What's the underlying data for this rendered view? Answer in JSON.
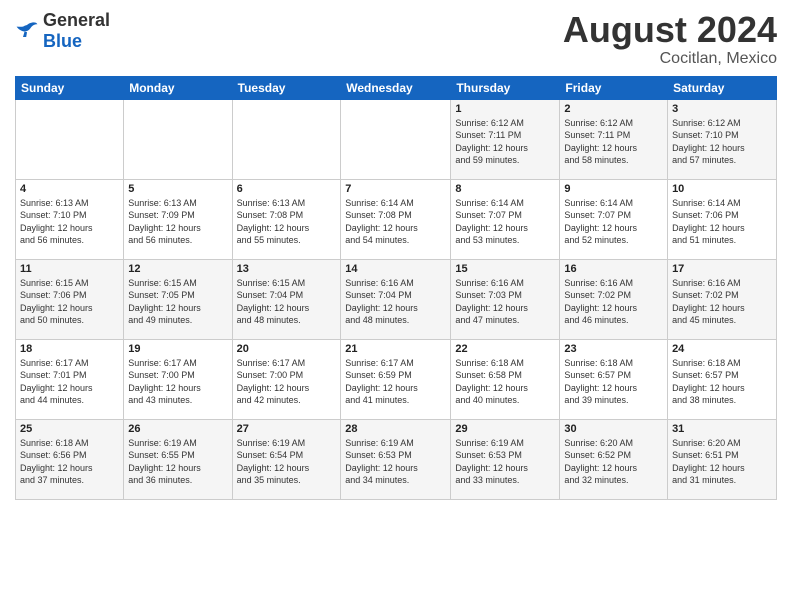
{
  "header": {
    "logo_general": "General",
    "logo_blue": "Blue",
    "main_title": "August 2024",
    "subtitle": "Cocitlan, Mexico"
  },
  "days_of_week": [
    "Sunday",
    "Monday",
    "Tuesday",
    "Wednesday",
    "Thursday",
    "Friday",
    "Saturday"
  ],
  "weeks": [
    [
      {
        "day": "",
        "info": ""
      },
      {
        "day": "",
        "info": ""
      },
      {
        "day": "",
        "info": ""
      },
      {
        "day": "",
        "info": ""
      },
      {
        "day": "1",
        "info": "Sunrise: 6:12 AM\nSunset: 7:11 PM\nDaylight: 12 hours\nand 59 minutes."
      },
      {
        "day": "2",
        "info": "Sunrise: 6:12 AM\nSunset: 7:11 PM\nDaylight: 12 hours\nand 58 minutes."
      },
      {
        "day": "3",
        "info": "Sunrise: 6:12 AM\nSunset: 7:10 PM\nDaylight: 12 hours\nand 57 minutes."
      }
    ],
    [
      {
        "day": "4",
        "info": "Sunrise: 6:13 AM\nSunset: 7:10 PM\nDaylight: 12 hours\nand 56 minutes."
      },
      {
        "day": "5",
        "info": "Sunrise: 6:13 AM\nSunset: 7:09 PM\nDaylight: 12 hours\nand 56 minutes."
      },
      {
        "day": "6",
        "info": "Sunrise: 6:13 AM\nSunset: 7:08 PM\nDaylight: 12 hours\nand 55 minutes."
      },
      {
        "day": "7",
        "info": "Sunrise: 6:14 AM\nSunset: 7:08 PM\nDaylight: 12 hours\nand 54 minutes."
      },
      {
        "day": "8",
        "info": "Sunrise: 6:14 AM\nSunset: 7:07 PM\nDaylight: 12 hours\nand 53 minutes."
      },
      {
        "day": "9",
        "info": "Sunrise: 6:14 AM\nSunset: 7:07 PM\nDaylight: 12 hours\nand 52 minutes."
      },
      {
        "day": "10",
        "info": "Sunrise: 6:14 AM\nSunset: 7:06 PM\nDaylight: 12 hours\nand 51 minutes."
      }
    ],
    [
      {
        "day": "11",
        "info": "Sunrise: 6:15 AM\nSunset: 7:06 PM\nDaylight: 12 hours\nand 50 minutes."
      },
      {
        "day": "12",
        "info": "Sunrise: 6:15 AM\nSunset: 7:05 PM\nDaylight: 12 hours\nand 49 minutes."
      },
      {
        "day": "13",
        "info": "Sunrise: 6:15 AM\nSunset: 7:04 PM\nDaylight: 12 hours\nand 48 minutes."
      },
      {
        "day": "14",
        "info": "Sunrise: 6:16 AM\nSunset: 7:04 PM\nDaylight: 12 hours\nand 48 minutes."
      },
      {
        "day": "15",
        "info": "Sunrise: 6:16 AM\nSunset: 7:03 PM\nDaylight: 12 hours\nand 47 minutes."
      },
      {
        "day": "16",
        "info": "Sunrise: 6:16 AM\nSunset: 7:02 PM\nDaylight: 12 hours\nand 46 minutes."
      },
      {
        "day": "17",
        "info": "Sunrise: 6:16 AM\nSunset: 7:02 PM\nDaylight: 12 hours\nand 45 minutes."
      }
    ],
    [
      {
        "day": "18",
        "info": "Sunrise: 6:17 AM\nSunset: 7:01 PM\nDaylight: 12 hours\nand 44 minutes."
      },
      {
        "day": "19",
        "info": "Sunrise: 6:17 AM\nSunset: 7:00 PM\nDaylight: 12 hours\nand 43 minutes."
      },
      {
        "day": "20",
        "info": "Sunrise: 6:17 AM\nSunset: 7:00 PM\nDaylight: 12 hours\nand 42 minutes."
      },
      {
        "day": "21",
        "info": "Sunrise: 6:17 AM\nSunset: 6:59 PM\nDaylight: 12 hours\nand 41 minutes."
      },
      {
        "day": "22",
        "info": "Sunrise: 6:18 AM\nSunset: 6:58 PM\nDaylight: 12 hours\nand 40 minutes."
      },
      {
        "day": "23",
        "info": "Sunrise: 6:18 AM\nSunset: 6:57 PM\nDaylight: 12 hours\nand 39 minutes."
      },
      {
        "day": "24",
        "info": "Sunrise: 6:18 AM\nSunset: 6:57 PM\nDaylight: 12 hours\nand 38 minutes."
      }
    ],
    [
      {
        "day": "25",
        "info": "Sunrise: 6:18 AM\nSunset: 6:56 PM\nDaylight: 12 hours\nand 37 minutes."
      },
      {
        "day": "26",
        "info": "Sunrise: 6:19 AM\nSunset: 6:55 PM\nDaylight: 12 hours\nand 36 minutes."
      },
      {
        "day": "27",
        "info": "Sunrise: 6:19 AM\nSunset: 6:54 PM\nDaylight: 12 hours\nand 35 minutes."
      },
      {
        "day": "28",
        "info": "Sunrise: 6:19 AM\nSunset: 6:53 PM\nDaylight: 12 hours\nand 34 minutes."
      },
      {
        "day": "29",
        "info": "Sunrise: 6:19 AM\nSunset: 6:53 PM\nDaylight: 12 hours\nand 33 minutes."
      },
      {
        "day": "30",
        "info": "Sunrise: 6:20 AM\nSunset: 6:52 PM\nDaylight: 12 hours\nand 32 minutes."
      },
      {
        "day": "31",
        "info": "Sunrise: 6:20 AM\nSunset: 6:51 PM\nDaylight: 12 hours\nand 31 minutes."
      }
    ]
  ]
}
